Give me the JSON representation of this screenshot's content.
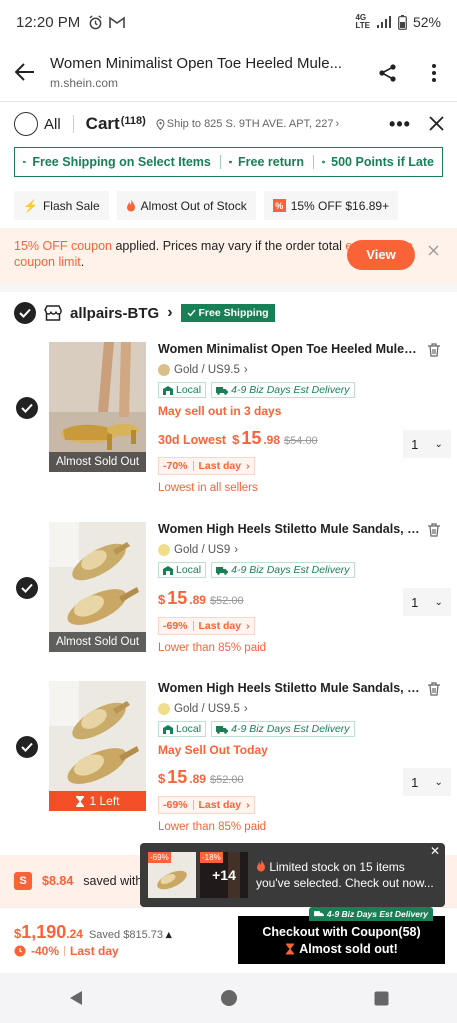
{
  "status": {
    "time": "12:20 PM",
    "battery": "52%",
    "network": "4G LTE"
  },
  "browser": {
    "title": "Women Minimalist Open Toe Heeled Mule...",
    "url": "m.shein.com"
  },
  "cart_header": {
    "all_label": "All",
    "cart_label": "Cart",
    "count": "(118)",
    "ship_to": "Ship to 825 S. 9TH AVE. APT, 227"
  },
  "benefits": {
    "free_shipping": "Free Shipping on Select Items",
    "free_return": "Free return",
    "points": "500 Points if Late"
  },
  "chips": [
    {
      "label": "Flash Sale"
    },
    {
      "label": "Almost Out of Stock"
    },
    {
      "label": "15% OFF $16.89+"
    }
  ],
  "coupon": {
    "highlight": "15% OFF coupon",
    "text": " applied. Prices may vary if the order total ",
    "highlight2": "exceeds the coupon limit",
    "end": ".",
    "button": "View"
  },
  "store": {
    "name": "allpairs-BTG",
    "badge": "Free Shipping"
  },
  "items": [
    {
      "title": "Women Minimalist Open Toe Heeled Mule Sa...",
      "variant": "Gold / US9.5",
      "swatch": "#d9c08a",
      "tag_local": "Local",
      "tag_delivery": "4-9 Biz Days Est Delivery",
      "warning": "May sell out in 3 days",
      "price_label": "30d Lowest",
      "currency": "$",
      "price_int": "15",
      "price_dec": ".98",
      "original": "$54.00",
      "qty": "1",
      "discount": "-70%",
      "discount_tag": "Last day",
      "note": "Lowest in all sellers",
      "image_caption": "Almost Sold Out"
    },
    {
      "title": "Women High Heels Stiletto Mule Sandals, Sex...",
      "variant": "Gold / US9",
      "swatch": "#f0de8c",
      "tag_local": "Local",
      "tag_delivery": "4-9 Biz Days Est Delivery",
      "warning": "",
      "price_label": "",
      "currency": "$",
      "price_int": "15",
      "price_dec": ".89",
      "original": "$52.00",
      "qty": "1",
      "discount": "-69%",
      "discount_tag": "Last day",
      "note": "Lower than 85% paid",
      "image_caption": "Almost Sold Out"
    },
    {
      "title": "Women High Heels Stiletto Mule Sandals, Sex...",
      "variant": "Gold / US9.5",
      "swatch": "#f0de8c",
      "tag_local": "Local",
      "tag_delivery": "4-9 Biz Days Est Delivery",
      "warning": "May Sell Out Today",
      "price_label": "",
      "currency": "$",
      "price_int": "15",
      "price_dec": ".89",
      "original": "$52.00",
      "qty": "1",
      "discount": "-69%",
      "discount_tag": "Last day",
      "note": "Lower than 85% paid",
      "image_caption": "1 Left"
    }
  ],
  "saved_bar": {
    "amount": "$8.84",
    "text": "saved with"
  },
  "popup": {
    "pct1": "-69%",
    "pct2": "-18%",
    "more": "+14",
    "text": "Limited stock on 15 items you've selected. Check out now..."
  },
  "checkout": {
    "currency": "$",
    "total_int": "1,190",
    "total_dec": ".24",
    "saved": "Saved $815.73",
    "discount": "-40%",
    "discount_tag": "Last day",
    "button": "Checkout with Coupon(58)",
    "button_sub": "Almost sold out!",
    "delivery_tag": "4-9 Biz Days Est Delivery"
  },
  "colors": {
    "accent": "#fa6338",
    "green": "#198055",
    "black": "#000000"
  }
}
